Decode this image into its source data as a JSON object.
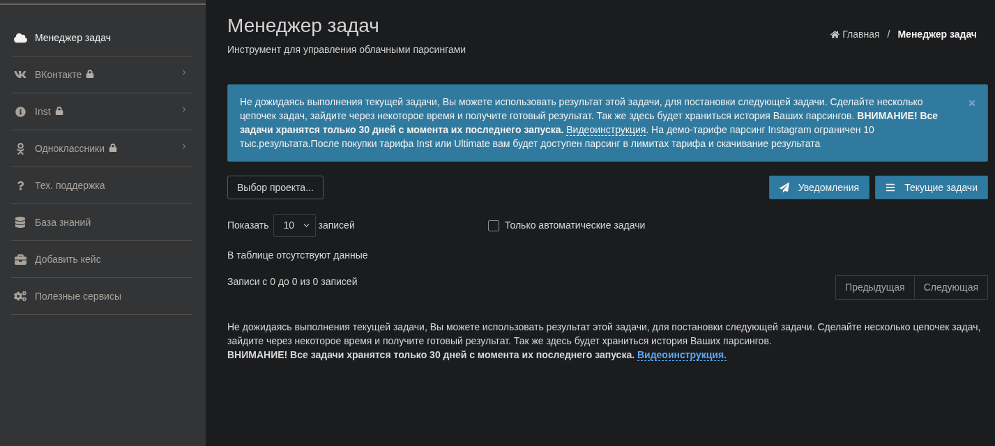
{
  "sidebar": {
    "items": [
      {
        "label": "Менеджер задач",
        "selected": true,
        "locked": false,
        "expandable": false
      },
      {
        "label": "ВКонтакте",
        "selected": false,
        "locked": true,
        "expandable": true
      },
      {
        "label": "Inst",
        "selected": false,
        "locked": true,
        "expandable": true
      },
      {
        "label": "Одноклассники",
        "selected": false,
        "locked": true,
        "expandable": true
      },
      {
        "label": "Тех. поддержка",
        "selected": false,
        "locked": false,
        "expandable": false
      },
      {
        "label": "База знаний",
        "selected": false,
        "locked": false,
        "expandable": false
      },
      {
        "label": "Добавить кейс",
        "selected": false,
        "locked": false,
        "expandable": false
      },
      {
        "label": "Полезные сервисы",
        "selected": false,
        "locked": false,
        "expandable": false
      }
    ]
  },
  "header": {
    "title": "Менеджер задач",
    "subtitle": "Инструмент для управления облачными парсингами",
    "breadcrumb": {
      "items": [
        {
          "label": "Главная",
          "current": false
        },
        {
          "label": "Менеджер задач",
          "current": true
        }
      ],
      "separator": "/"
    }
  },
  "alert": {
    "text": "Не дожидаясь выполнения текущей задачи, Вы можете использовать результат этой задачи, для постановки следующей задачи. Сделайте несколько цепочек задач, зайдите через некоторое время и получите готовый результат. Так же здесь будет храниться история Ваших парсингов. **ВНИМАНИЕ! Все задачи хранятся только 30 дней с момента их последнего запуска.**",
    "link": "Видеоинструкция",
    "text_after": ". На демо-тарифе парсинг Instagram ограничен 10 тыс.результата.После покупки тарифа Inst или Ultimate вам будет доступен парсинг в лимитах тарифа и скачивание результата",
    "dismissible": true
  },
  "toolbar": {
    "project_button": "Выбор проекта...",
    "actions": [
      "Уведомления",
      "Текущие задачи"
    ]
  },
  "table": {
    "length": {
      "label_before": "Показать",
      "value": "10",
      "label_after": "записей"
    },
    "auto_only": {
      "label": "Только автоматические задачи",
      "checked": false
    },
    "empty_message": "В таблице отсутствуют данные",
    "info": "Записи с 0 до 0 из 0 записей",
    "pagination": [
      {
        "label": "Предыдущая",
        "disabled": true
      },
      {
        "label": "Следующая",
        "disabled": true
      }
    ]
  },
  "note": {
    "text": "Не дожидаясь выполнения текущей задачи, Вы можете использовать результат этой задачи, для постановки следующей задачи. Сделайте несколько цепочек задач, зайдите через некоторое время и получите готовый результат. Так же здесь будет храниться история Ваших парсингов.",
    "warning": "ВНИМАНИЕ! Все задачи хранятся только 30 дней с момента их последнего запуска.",
    "link": "Видеоинструкция."
  }
}
